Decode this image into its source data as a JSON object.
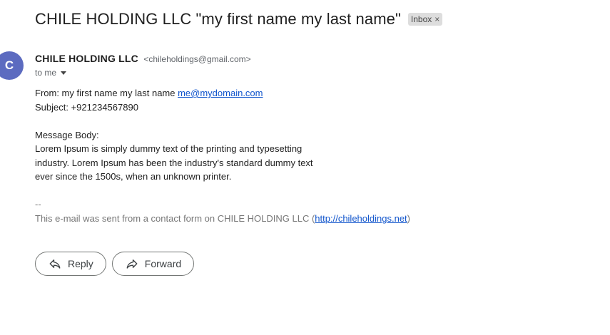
{
  "email": {
    "subject": "CHILE HOLDING LLC \"my first name my last name\"",
    "label": "Inbox",
    "label_close": "×",
    "avatar_letter": "C",
    "avatar_color": "#5c6bc0",
    "sender_name": "CHILE HOLDING LLC",
    "sender_email": "<chileholdings@gmail.com>",
    "recipient": "to me",
    "body": {
      "from_prefix": "From: my first name my last name ",
      "from_email": "me@mydomain.com",
      "subject_line": "Subject: +921234567890",
      "message_heading": "Message Body:",
      "message_line1": "Lorem Ipsum is simply dummy text of the printing and typesetting",
      "message_line2": "industry. Lorem Ipsum has been the industry's standard dummy text",
      "message_line3": "ever since the 1500s, when an unknown printer.",
      "separator": "--",
      "footer_prefix": "This e-mail was sent from a contact form on CHILE HOLDING LLC (",
      "footer_link": "http://chileholdings.net",
      "footer_suffix": ")"
    }
  },
  "actions": {
    "reply_label": "Reply",
    "forward_label": "Forward",
    "reply_icon": "reply-icon",
    "forward_icon": "forward-icon"
  },
  "colors": {
    "link": "#1155cc",
    "chip_bg": "#dddddd"
  }
}
